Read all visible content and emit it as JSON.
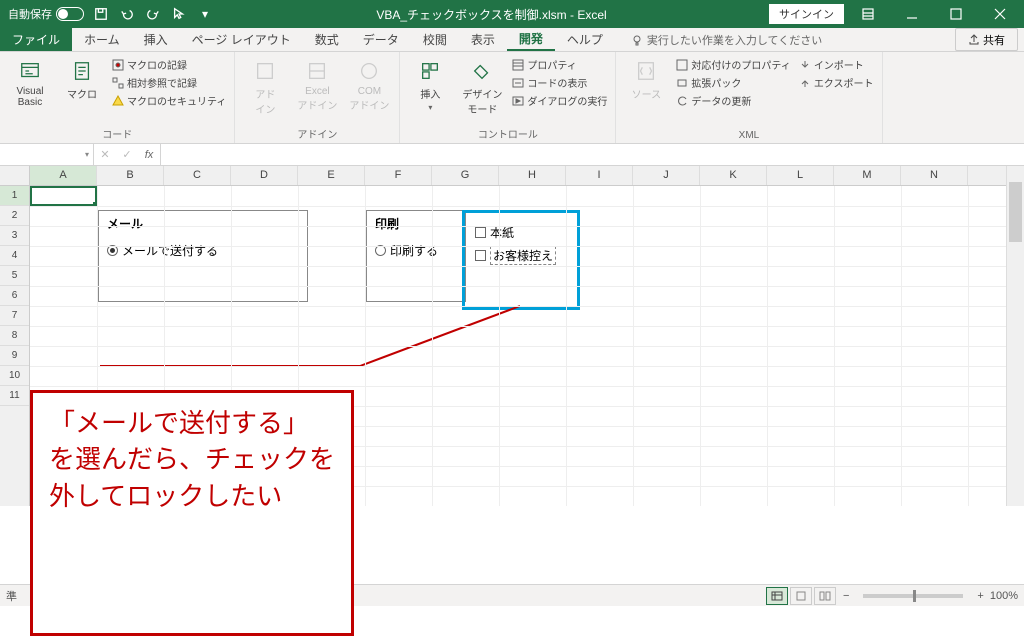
{
  "titlebar": {
    "autosave_label": "自動保存",
    "autosave_toggle": "オフ",
    "filename": "VBA_チェックボックスを制御.xlsm - Excel",
    "signin": "サインイン"
  },
  "tabs": {
    "file": "ファイル",
    "home": "ホーム",
    "insert": "挿入",
    "pagelayout": "ページ レイアウト",
    "formulas": "数式",
    "data": "データ",
    "review": "校閲",
    "view": "表示",
    "developer": "開発",
    "help": "ヘルプ",
    "tellme": "実行したい作業を入力してください",
    "share": "共有"
  },
  "ribbon": {
    "code": {
      "vb": "Visual Basic",
      "macros": "マクロ",
      "record": "マクロの記録",
      "relative": "相対参照で記録",
      "security": "マクロのセキュリティ",
      "group": "コード"
    },
    "addins": {
      "addin": "アド\nイン",
      "excel": "Excel\nアドイン",
      "com": "COM\nアドイン",
      "group": "アドイン"
    },
    "controls": {
      "insert": "挿入",
      "design": "デザイン\nモード",
      "properties": "プロパティ",
      "viewcode": "コードの表示",
      "rundlg": "ダイアログの実行",
      "group": "コントロール"
    },
    "xml": {
      "source": "ソース",
      "mapprops": "対応付けのプロパティ",
      "expansion": "拡張パック",
      "refresh": "データの更新",
      "import": "インポート",
      "export": "エクスポート",
      "group": "XML"
    }
  },
  "formula_bar": {
    "namebox_value": "",
    "fx": "fx"
  },
  "columns": [
    "A",
    "B",
    "C",
    "D",
    "E",
    "F",
    "G",
    "H",
    "I",
    "J",
    "K",
    "L",
    "M",
    "N"
  ],
  "rows": [
    "1",
    "2",
    "3",
    "4",
    "5",
    "6",
    "7",
    "8",
    "9",
    "10",
    "11"
  ],
  "sheet": {
    "mail": {
      "title": "メール",
      "radio_send": "メールで送付する"
    },
    "print": {
      "title": "印刷",
      "radio_print": "印刷する",
      "chk_main": "本紙",
      "chk_copy": "お客様控え"
    }
  },
  "callout": {
    "line1": "「メールで送付する」",
    "line2": "を選んだら、チェックを",
    "line3": "外してロックしたい"
  },
  "status": {
    "ready": "準",
    "zoom": "100%",
    "plus": "+",
    "minus": "−"
  }
}
